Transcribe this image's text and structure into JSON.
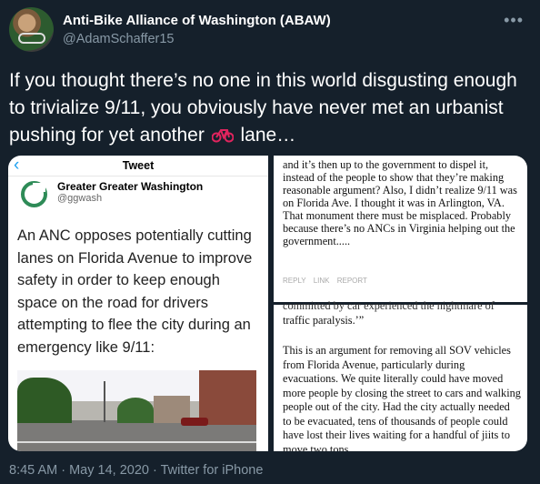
{
  "author": {
    "name": "Anti-Bike Alliance of Washington (ABAW)",
    "handle": "@AdamSchaffer15"
  },
  "tweet": {
    "text_before_emoji": "If you thought there’s no one in this world disgusting enough to trivialize 9/11, you obviously have never met an urbanist pushing for yet another",
    "emoji": "bicycle-emoji",
    "text_after_emoji": "lane…"
  },
  "embedded_tweet": {
    "header_title": "Tweet",
    "account_name": "Greater Greater Washington",
    "account_handle": "@ggwash",
    "body": "An ANC opposes potentially cutting lanes on Florida Avenue to improve safety in order to keep enough space on the road for drivers attempting to flee the city during an emergency like 9/11:"
  },
  "comment_top": {
    "text": "and it’s then up to the government to dispel it, instead of the people to show that they’re making reasonable argument? Also, I didn’t realize 9/11 was on Florida Ave. I thought it was in Arlington, VA. That monument there must be misplaced. Probably because there’s no ANCs in Virginia helping out the government.....",
    "actions": "REPLY LINK REPORT"
  },
  "comment_bottom": {
    "cut_line": "committed by car experienced the nightmare of",
    "p1": "traffic paralysis.’”",
    "p2": "This is an argument for removing all SOV vehicles from Florida Avenue, particularly during evacuations. We quite literally could have moved more people by closing the street to cars and walking people out of the city. Had the city actually needed to be evacuated, tens of thousands of people could have lost their lives waiting for a handful of jiits to move two tons"
  },
  "meta": "8:45 AM · May 14, 2020 · Twitter for iPhone",
  "icons": {
    "more": "more-icon",
    "back": "back-chevron-icon"
  }
}
